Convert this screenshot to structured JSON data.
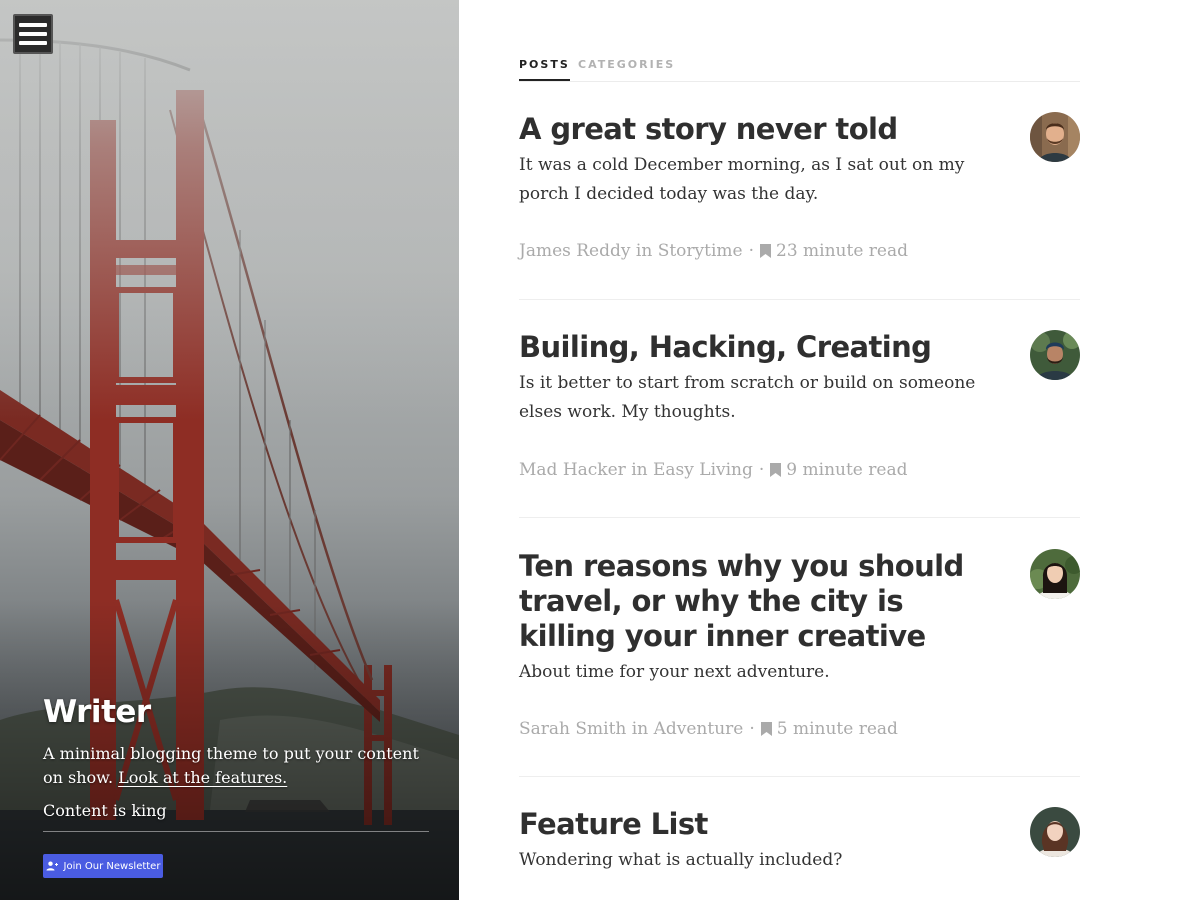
{
  "sidebar": {
    "title": "Writer",
    "description": "A minimal blogging theme to put your content on show.",
    "features_link": "Look at the features.",
    "tagline": "Content is king",
    "newsletter_label": "Join Our Newsletter"
  },
  "tabs": [
    {
      "label": "POSTS",
      "active": true
    },
    {
      "label": "CATEGORIES",
      "active": false
    }
  ],
  "posts": [
    {
      "title": "A great story never told",
      "excerpt": "It was a cold December morning, as I sat out on my porch I decided today was the day.",
      "author": "James Reddy",
      "in": "in",
      "category": "Storytime",
      "read_time": "23 minute read"
    },
    {
      "title": "Builing, Hacking, Creating",
      "excerpt": "Is it better to start from scratch or build on someone elses work. My thoughts.",
      "author": "Mad Hacker",
      "in": "in",
      "category": "Easy Living",
      "read_time": "9 minute read"
    },
    {
      "title": "Ten reasons why you should travel, or why the city is killing your inner creative",
      "excerpt": "About time for your next adventure.",
      "author": "Sarah Smith",
      "in": "in",
      "category": "Adventure",
      "read_time": "5 minute read"
    },
    {
      "title": "Feature List",
      "excerpt": "Wondering what is actually included?",
      "author": "",
      "in": "",
      "category": "",
      "read_time": ""
    }
  ],
  "colors": {
    "accent": "#4a5ce2",
    "bridge_red": "#8e2d24",
    "meta_gray": "#aaaaaa"
  },
  "icons": [
    "menu-icon",
    "user-plus-icon",
    "bookmark-icon"
  ]
}
